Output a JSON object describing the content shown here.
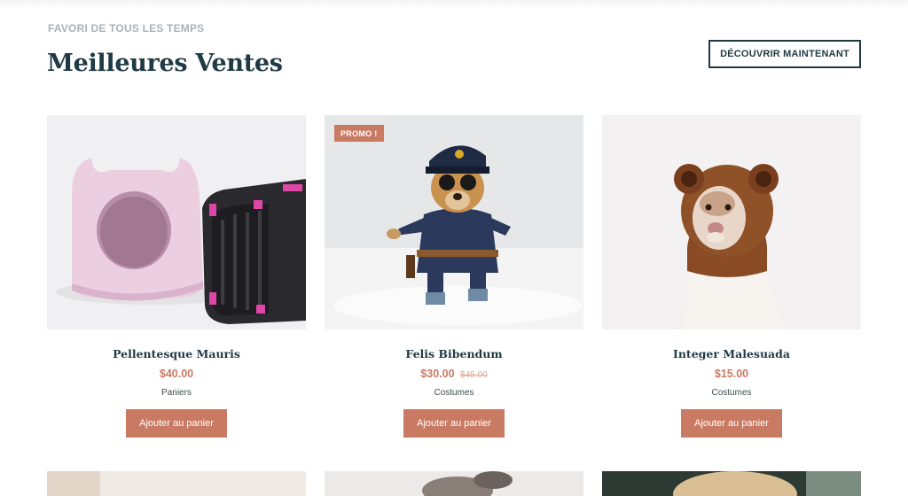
{
  "header": {
    "eyebrow": "FAVORI DE TOUS LES TEMPS",
    "title": "Meilleures Ventes",
    "cta_label": "DÉCOUVRIR MAINTENANT"
  },
  "products": [
    {
      "name": "Pellentesque Mauris",
      "price": "$40.00",
      "old_price": "",
      "category": "Paniers",
      "button": "Ajouter au panier",
      "badge": ""
    },
    {
      "name": "Felis Bibendum",
      "price": "$30.00",
      "old_price": "$45.00",
      "category": "Costumes",
      "button": "Ajouter au panier",
      "badge": "PROMO !"
    },
    {
      "name": "Integer Malesuada",
      "price": "$15.00",
      "old_price": "",
      "category": "Costumes",
      "button": "Ajouter au panier",
      "badge": ""
    }
  ],
  "colors": {
    "accent": "#c97a63",
    "text": "#1f3a45",
    "muted": "#a9b2b6"
  }
}
